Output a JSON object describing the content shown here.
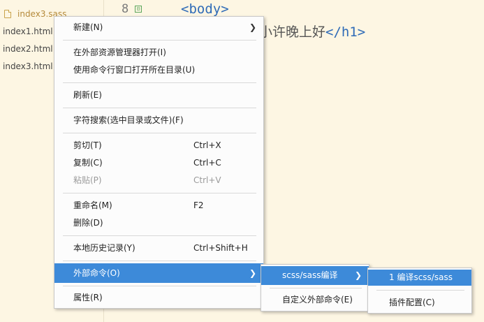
{
  "sidebar": {
    "active_file": "index3.sass",
    "files": [
      "index1.html",
      "index2.html",
      "index3.html"
    ]
  },
  "editor": {
    "line_number": "8",
    "fold_symbol": "⊟",
    "line1": "<body>",
    "line2_text": "小许晚上好",
    "line2_close": "</h1>"
  },
  "context_menu": {
    "new": "新建(N)",
    "open_in_explorer": "在外部资源管理器打开(I)",
    "open_in_cmd": "使用命令行窗口打开所在目录(U)",
    "refresh": "刷新(E)",
    "char_search": "字符搜索(选中目录或文件)(F)",
    "cut": "剪切(T)",
    "cut_shortcut": "Ctrl+X",
    "copy": "复制(C)",
    "copy_shortcut": "Ctrl+C",
    "paste": "粘贴(P)",
    "paste_shortcut": "Ctrl+V",
    "rename": "重命名(M)",
    "rename_shortcut": "F2",
    "delete": "删除(D)",
    "local_history": "本地历史记录(Y)",
    "local_history_shortcut": "Ctrl+Shift+H",
    "external_commands": "外部命令(O)",
    "properties": "属性(R)"
  },
  "submenu1": {
    "scss_compile": "scss/sass编译",
    "custom_command": "自定义外部命令(E)"
  },
  "submenu2": {
    "compile": "1 编译scss/sass",
    "plugin_config": "插件配置(C)"
  },
  "colors": {
    "highlight": "#3d8ad9",
    "tag_blue": "#2f6bb7",
    "background": "#fdf6e3"
  }
}
